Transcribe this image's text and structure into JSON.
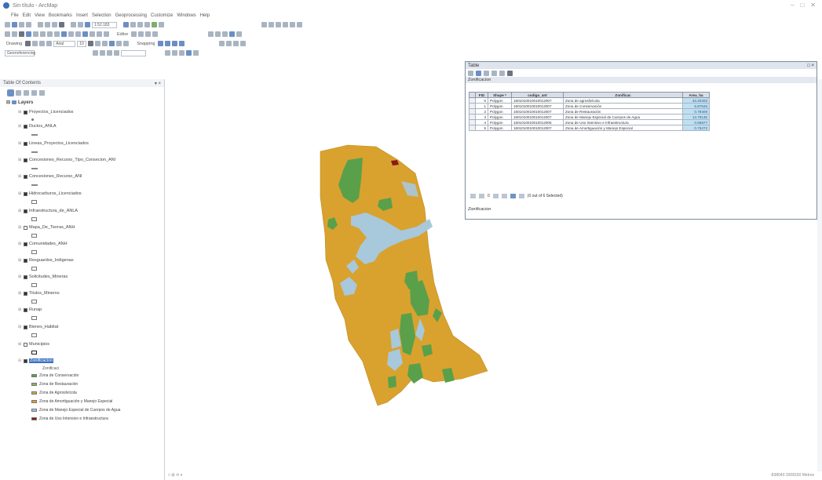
{
  "window": {
    "title": "Sin título - ArcMap",
    "controls": [
      "–",
      "□",
      "✕"
    ]
  },
  "menu": [
    "File",
    "Edit",
    "View",
    "Bookmarks",
    "Insert",
    "Selection",
    "Geoprocessing",
    "Customize",
    "Windows",
    "Help"
  ],
  "toolbar": {
    "scale_value": "1:52.183",
    "editor_label": "Editor",
    "drawing_label": "Drawing",
    "font_value": "Arial",
    "font_size": "10",
    "snapping_label": "Snapping",
    "georef_value": "Georreferencing"
  },
  "toc": {
    "title": "Table Of Contents",
    "root": "Layers",
    "layers": [
      {
        "name": "Proyectos_Licenciados",
        "checked": true
      },
      {
        "name": "Ductos_ANLA",
        "checked": true
      },
      {
        "name": "Lineas_Proyectos_Licenciados",
        "checked": true
      },
      {
        "name": "Concesiones_Recurso_Tipo_Consecion_ANI",
        "checked": true
      },
      {
        "name": "Concesiones_Recurso_ANI",
        "checked": true
      },
      {
        "name": "Hidrocarburos_Licenciados",
        "checked": true
      },
      {
        "name": "Infraestructura_de_ANLA",
        "checked": true
      },
      {
        "name": "Mapa_De_Tierras_ANH",
        "checked": false
      },
      {
        "name": "Comunidades_ANH",
        "checked": true
      },
      {
        "name": "Resguardos_Indigenas",
        "checked": true
      },
      {
        "name": "Solicitudes_Mineras",
        "checked": true
      },
      {
        "name": "Titulos_Mineros",
        "checked": true
      },
      {
        "name": "Runap",
        "checked": true
      },
      {
        "name": "Bienes_Habitat",
        "checked": true
      },
      {
        "name": "Municipios",
        "checked": false
      },
      {
        "name": "Zonificacion",
        "checked": true
      }
    ],
    "legend_field": "Zonificaci",
    "legend": [
      {
        "label": "Zona de Conservación",
        "color": "#5aa04a"
      },
      {
        "label": "Zona de Restauración",
        "color": "#8db05a"
      },
      {
        "label": "Zona de Agrosilvícola",
        "color": "#c9a93c"
      },
      {
        "label": "Zona de Amortiguación y Manejo Especial",
        "color": "#e0a030"
      },
      {
        "label": "Zona de Manejo Especial de Cuerpos de Agua",
        "color": "#9fc7e0"
      },
      {
        "label": "Zona de Uso Intensivo e Infraestructura",
        "color": "#8b1a1a"
      }
    ]
  },
  "attribute_table": {
    "window_title": "Table",
    "tab_label": "Zonificacion",
    "columns": [
      "FID",
      "Shape *",
      "codigo_ant",
      "Zonificac",
      "Area_ha"
    ],
    "rows": [
      [
        "0",
        "Polygon",
        "1601010010010012007",
        "Zona de agrosilvícola",
        "43.20403"
      ],
      [
        "1",
        "Polygon",
        "1601010010010012007",
        "Zona de Conservación",
        "6.87646"
      ],
      [
        "2",
        "Polygon",
        "1601010010010012007",
        "Zona de Restauración",
        "0.78409"
      ],
      [
        "3",
        "Polygon",
        "1601010010010012007",
        "Zona de Manejo Especial de Cuerpos de Agua",
        "14.78135"
      ],
      [
        "4",
        "Polygon",
        "1601010010010012005",
        "Zona de Uso Intensivo e Infraestructura",
        "0.56977"
      ],
      [
        "5",
        "Polygon",
        "1601010010010012007",
        "Zona de Amortiguación y Manejo Especial",
        "0.75272"
      ]
    ],
    "nav": {
      "record": "0",
      "status": "(0 out of 6 Selected)"
    },
    "footer_tab": "Zonificacion"
  },
  "map": {
    "colors": {
      "base": "#d9a22e",
      "conservation": "#5aa04a",
      "water": "#a8c8dc",
      "infrastructure": "#8b1a1a"
    }
  },
  "status_bar": {
    "left": "□ ⊞ ⟲ ⏸",
    "coords": "-838040 2008150 Metros"
  }
}
